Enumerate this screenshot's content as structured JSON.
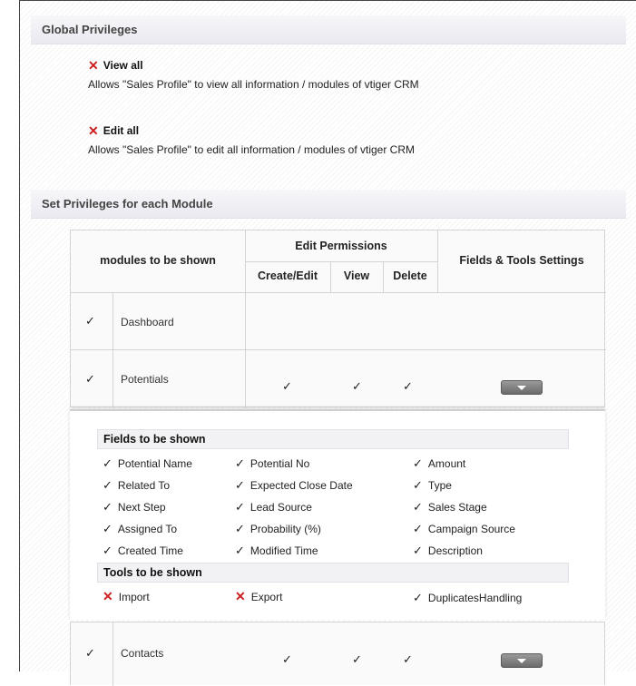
{
  "global_privileges": {
    "title": "Global Privileges",
    "items": [
      {
        "label": "View all",
        "description": "Allows \"Sales Profile\" to view all information / modules of vtiger CRM"
      },
      {
        "label": "Edit all",
        "description": "Allows \"Sales Profile\" to edit all information / modules of vtiger CRM"
      }
    ]
  },
  "module_privileges": {
    "title": "Set Privileges for each Module",
    "headers": {
      "modules": "modules to be shown",
      "edit_permissions": "Edit Permissions",
      "create_edit": "Create/Edit",
      "view": "View",
      "delete": "Delete",
      "fields_tools": "Fields & Tools Settings"
    },
    "modules": [
      {
        "name": "Dashboard"
      },
      {
        "name": "Potentials"
      },
      {
        "name": "Contacts"
      }
    ]
  },
  "panel": {
    "fields_title": "Fields to be shown",
    "fields": [
      "Potential Name",
      "Potential No",
      "Amount",
      "Related To",
      "Expected Close Date",
      "Type",
      "Next Step",
      "Lead Source",
      "Sales Stage",
      "Assigned To",
      "Probability (%)",
      "Campaign Source",
      "Created Time",
      "Modified Time",
      "Description"
    ],
    "tools_title": "Tools to be shown",
    "tools": [
      {
        "label": "Import",
        "enabled": false
      },
      {
        "label": "Export",
        "enabled": false
      },
      {
        "label": "DuplicatesHandling",
        "enabled": true
      }
    ]
  },
  "icons": {
    "check": "✓",
    "cross": "✕"
  },
  "colors": {
    "cross": "#cc1f1f",
    "section_bar": "#ececf2"
  }
}
